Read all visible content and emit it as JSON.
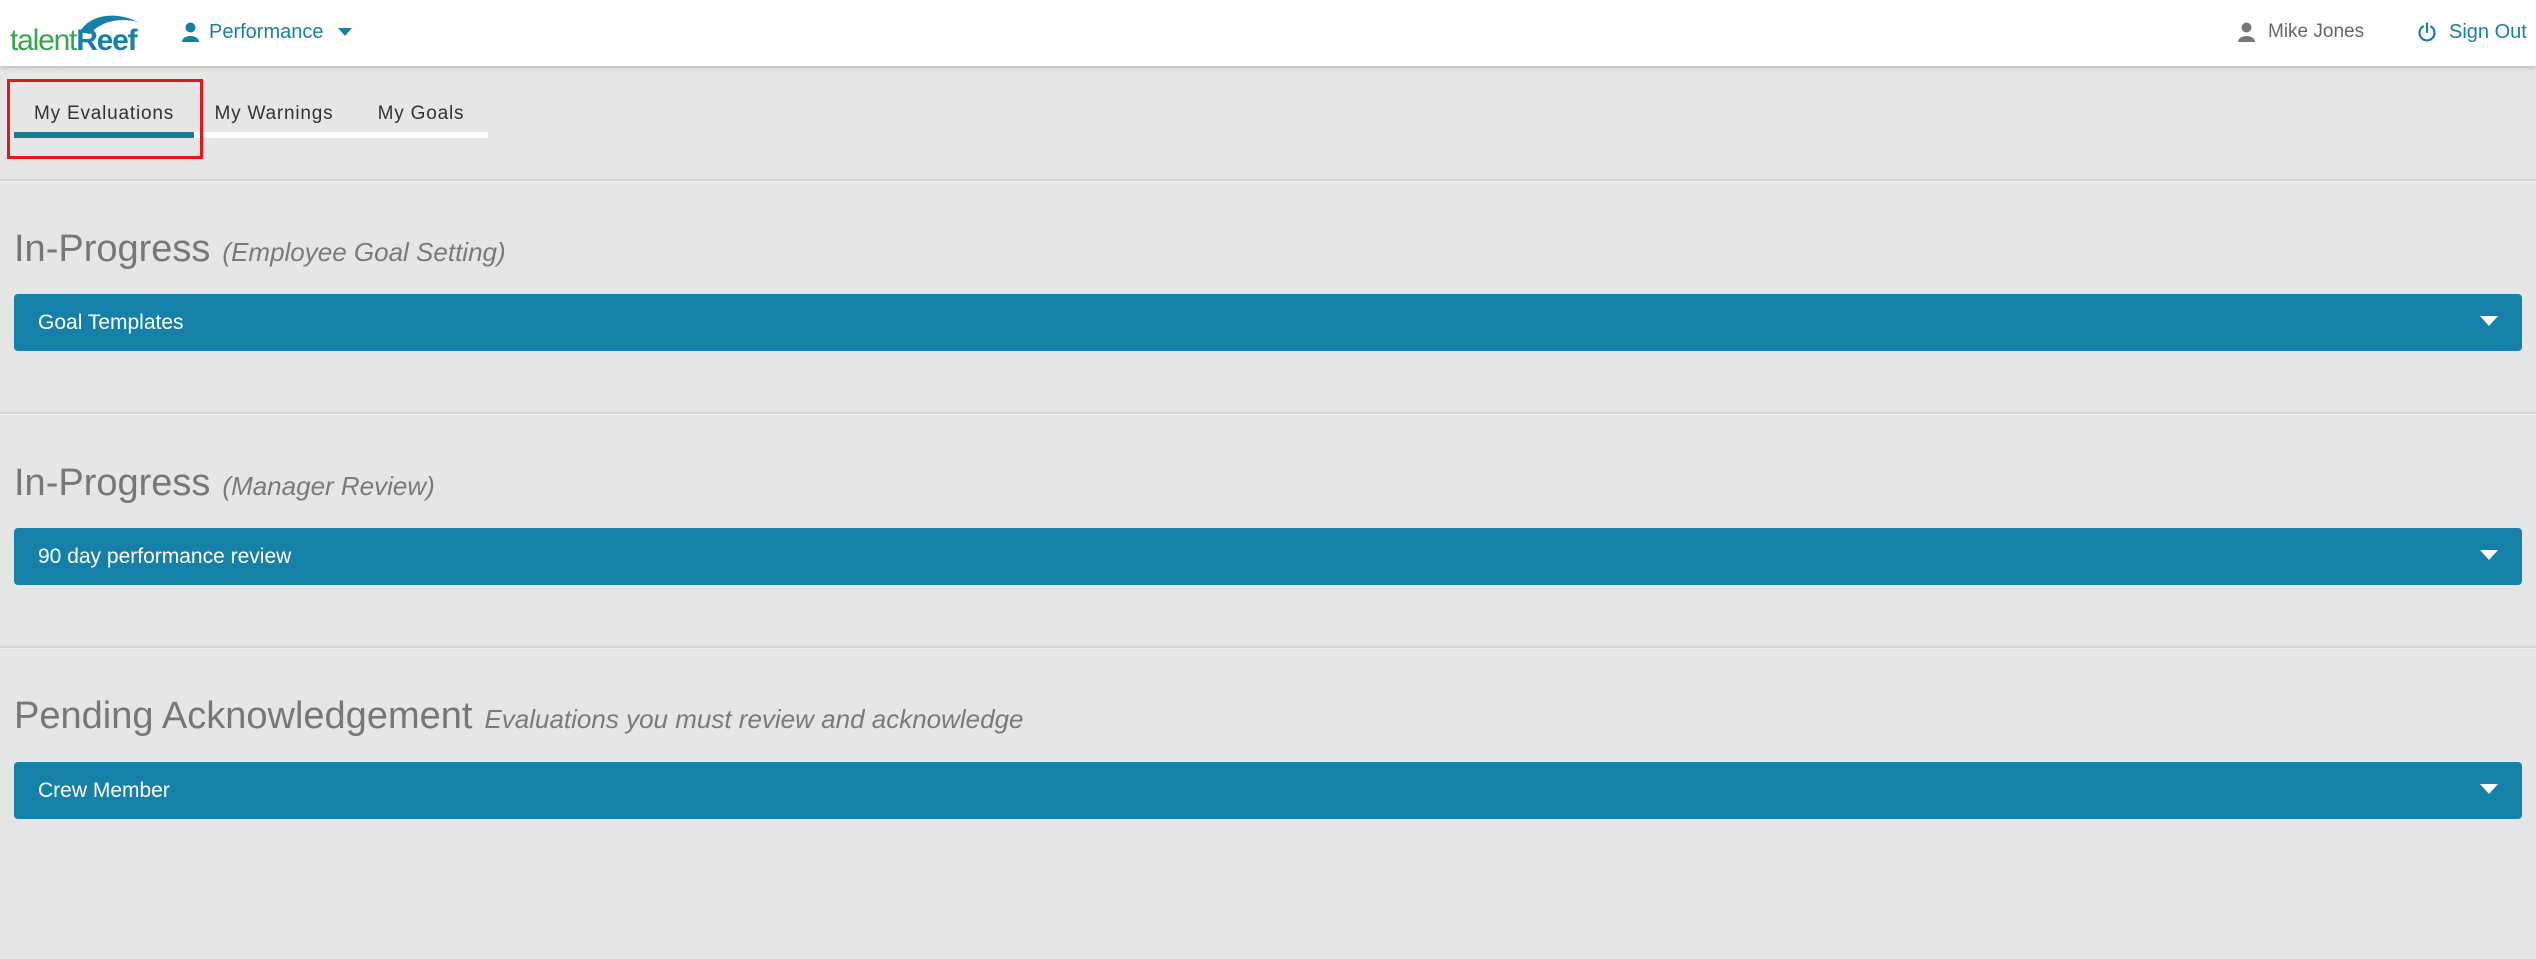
{
  "app": {
    "logo_text": "talentReef",
    "logo_part1": "talent",
    "logo_part2": "Reef",
    "module_label": "Performance"
  },
  "user": {
    "name": "Mike Jones",
    "signout_label": "Sign Out"
  },
  "tabs": [
    {
      "label": "My Evaluations",
      "active": true
    },
    {
      "label": "My Warnings",
      "active": false
    },
    {
      "label": "My Goals",
      "active": false
    }
  ],
  "sections": [
    {
      "title": "In-Progress",
      "subtitle": "(Employee Goal Setting)",
      "panels": [
        {
          "label": "Goal Templates"
        }
      ]
    },
    {
      "title": "In-Progress",
      "subtitle": "(Manager Review)",
      "panels": [
        {
          "label": "90 day performance review"
        }
      ]
    },
    {
      "title": "Pending Acknowledgement",
      "subtitle": "Evaluations you must review and acknowledge",
      "panels": [
        {
          "label": "Crew Member"
        }
      ]
    }
  ],
  "icons": {
    "module": "person-icon",
    "module_menu": "caret-down-icon",
    "user": "user-icon",
    "signout": "power-icon",
    "panel_toggle": "caret-down-icon"
  },
  "colors": {
    "brand_blue": "#1681a8",
    "brand_green": "#35a64a",
    "active_tab_underline": "#1e7a93",
    "page_background": "#e6e6e6",
    "highlight_box": "#e8161b"
  }
}
